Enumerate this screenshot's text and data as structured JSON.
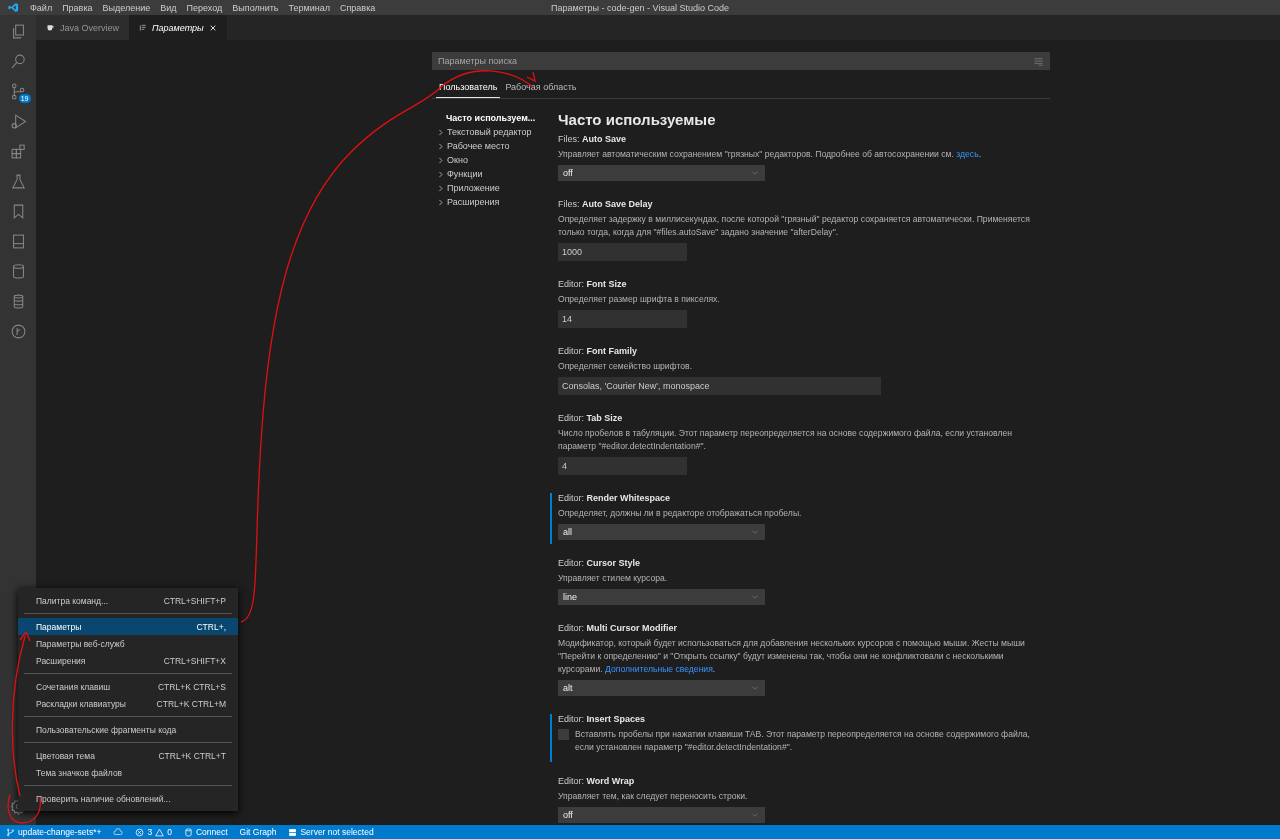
{
  "window": {
    "title": "Параметры - code-gen - Visual Studio Code"
  },
  "menu_bar": [
    "Файл",
    "Правка",
    "Выделение",
    "Вид",
    "Переход",
    "Выполнить",
    "Терминал",
    "Справка"
  ],
  "activity_bar": {
    "source_control_badge": "19"
  },
  "editor_tabs": [
    {
      "label": "Java Overview",
      "selected": false
    },
    {
      "label": "Параметры",
      "selected": true
    }
  ],
  "settings": {
    "search": {
      "placeholder": "Параметры поиска"
    },
    "scope_tabs": [
      {
        "label": "Пользователь",
        "selected": true
      },
      {
        "label": "Рабочая область",
        "selected": false
      }
    ],
    "toc": [
      {
        "label": "Часто используем...",
        "selected": true,
        "expandable": false
      },
      {
        "label": "Текстовый редактор",
        "selected": false,
        "expandable": true
      },
      {
        "label": "Рабочее место",
        "selected": false,
        "expandable": true
      },
      {
        "label": "Окно",
        "selected": false,
        "expandable": true
      },
      {
        "label": "Функции",
        "selected": false,
        "expandable": true
      },
      {
        "label": "Приложение",
        "selected": false,
        "expandable": true
      },
      {
        "label": "Расширения",
        "selected": false,
        "expandable": true
      }
    ],
    "heading": "Часто используемые",
    "items": [
      {
        "title": "Files: **Auto Save**",
        "description": "Управляет автоматическим сохранением \"грязных\" редакторов. Подробнее об автосохранении см. ",
        "link": "здесь",
        "link_after": ".",
        "kind": "select",
        "value": "off",
        "modified": false
      },
      {
        "title": "Files: **Auto Save Delay**",
        "description": "Определяет задержку в миллисекундах, после которой \"грязный\" редактор сохраняется автоматически. Применяется только тогда, когда для \"#files.autoSave\" задано значение \"afterDelay\".",
        "kind": "number",
        "value": "1000",
        "modified": false
      },
      {
        "title": "Editor: **Font Size**",
        "description": "Определяет размер шрифта в пикселях.",
        "kind": "number",
        "value": "14",
        "modified": false
      },
      {
        "title": "Editor: **Font Family**",
        "description": "Определяет семейство шрифтов.",
        "kind": "text",
        "value": "Consolas, 'Courier New', monospace",
        "modified": false
      },
      {
        "title": "Editor: **Tab Size**",
        "description": "Число пробелов в табуляции. Этот параметр переопределяется на основе содержимого файла, если установлен параметр \"#editor.detectIndentation#\".",
        "kind": "number",
        "value": "4",
        "modified": false
      },
      {
        "title": "Editor: **Render Whitespace**",
        "description": "Определяет, должны ли в редакторе отображаться пробелы.",
        "kind": "select",
        "value": "all",
        "modified": true
      },
      {
        "title": "Editor: **Cursor Style**",
        "description": "Управляет стилем курсора.",
        "kind": "select",
        "value": "line",
        "modified": false
      },
      {
        "title": "Editor: **Multi Cursor Modifier**",
        "description": "Модификатор, который будет использоваться для добавления нескольких курсоров с помощью мыши. Жесты мыши \"Перейти к определению\" и \"Открыть ссылку\" будут изменены так, чтобы они не конфликтовали с несколькими курсорами. ",
        "link": "Дополнительные сведения",
        "link_after": ".",
        "kind": "select",
        "value": "alt",
        "modified": false
      },
      {
        "title": "Editor: **Insert Spaces**",
        "description": "Вставлять пробелы при нажатии клавиши TAB. Этот параметр переопределяется на основе содержимого файла, если установлен параметр \"#editor.detectIndentation#\".",
        "kind": "checkbox",
        "checked": false,
        "modified": true
      },
      {
        "title": "Editor: **Word Wrap**",
        "description": "Управляет тем, как следует переносить строки.",
        "kind": "select",
        "value": "off",
        "modified": false
      }
    ]
  },
  "context_menu": {
    "groups": [
      [
        {
          "label": "Палитра команд...",
          "shortcut": "CTRL+SHIFT+P",
          "selected": false
        }
      ],
      [
        {
          "label": "Параметры",
          "shortcut": "CTRL+,",
          "selected": true
        },
        {
          "label": "Параметры веб-служб",
          "selected": false
        },
        {
          "label": "Расширения",
          "shortcut": "CTRL+SHIFT+X",
          "selected": false
        }
      ],
      [
        {
          "label": "Сочетания клавиш",
          "shortcut": "CTRL+K CTRL+S",
          "selected": false
        },
        {
          "label": "Раскладки клавиатуры",
          "shortcut": "CTRL+K CTRL+M",
          "selected": false
        }
      ],
      [
        {
          "label": "Пользовательские фрагменты кода",
          "selected": false
        }
      ],
      [
        {
          "label": "Цветовая тема",
          "shortcut": "CTRL+K CTRL+T",
          "selected": false
        },
        {
          "label": "Тема значков файлов",
          "selected": false
        }
      ],
      [
        {
          "label": "Проверить наличие обновлений...",
          "selected": false
        }
      ]
    ]
  },
  "status_bar": {
    "branch": "update-change-sets*+",
    "errors": "3",
    "warnings": "0",
    "items": [
      "Connect",
      "Git Graph",
      "Server not selected"
    ]
  }
}
